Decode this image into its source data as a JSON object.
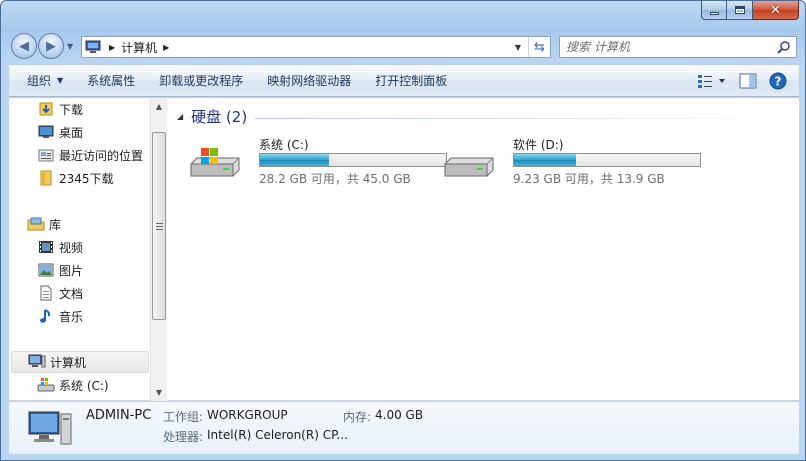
{
  "window": {
    "caption_buttons": [
      "minimize",
      "maximize",
      "close"
    ]
  },
  "address": {
    "path": [
      "计算机"
    ],
    "refresh_icon": "refresh-icon"
  },
  "search": {
    "placeholder": "搜索 计算机"
  },
  "toolbar": {
    "organize": "组织",
    "system_properties": "系统属性",
    "uninstall": "卸载或更改程序",
    "map_drive": "映射网络驱动器",
    "control_panel": "打开控制面板"
  },
  "navpane": {
    "items": [
      {
        "label": "下载",
        "icon": "downloads-folder-icon"
      },
      {
        "label": "桌面",
        "icon": "desktop-icon"
      },
      {
        "label": "最近访问的位置",
        "icon": "recent-places-icon"
      },
      {
        "label": "2345下载",
        "icon": "folder-icon"
      },
      {
        "label": "库",
        "icon": "libraries-icon"
      },
      {
        "label": "视频",
        "icon": "videos-icon"
      },
      {
        "label": "图片",
        "icon": "pictures-icon"
      },
      {
        "label": "文档",
        "icon": "documents-icon"
      },
      {
        "label": "音乐",
        "icon": "music-icon"
      },
      {
        "label": "计算机",
        "icon": "computer-icon"
      },
      {
        "label": "系统 (C:)",
        "icon": "system-drive-icon"
      }
    ]
  },
  "main": {
    "group_title": "硬盘 (2)",
    "drives": [
      {
        "name": "系统 (C:)",
        "free_text": "28.2 GB 可用，共 45.0 GB",
        "used_fraction": 0.373,
        "icon": "windows-drive-icon"
      },
      {
        "name": "软件 (D:)",
        "free_text": "9.23 GB 可用，共 13.9 GB",
        "used_fraction": 0.336,
        "icon": "hard-drive-icon"
      }
    ]
  },
  "details": {
    "computer_name": "ADMIN-PC",
    "workgroup_label": "工作组:",
    "workgroup_value": "WORKGROUP",
    "memory_label": "内存:",
    "memory_value": "4.00 GB",
    "processor_label": "处理器:",
    "processor_value": "Intel(R) Celeron(R) CP..."
  },
  "colors": {
    "accent": "#1e3287",
    "bar_fill": "#2ba2cf"
  }
}
